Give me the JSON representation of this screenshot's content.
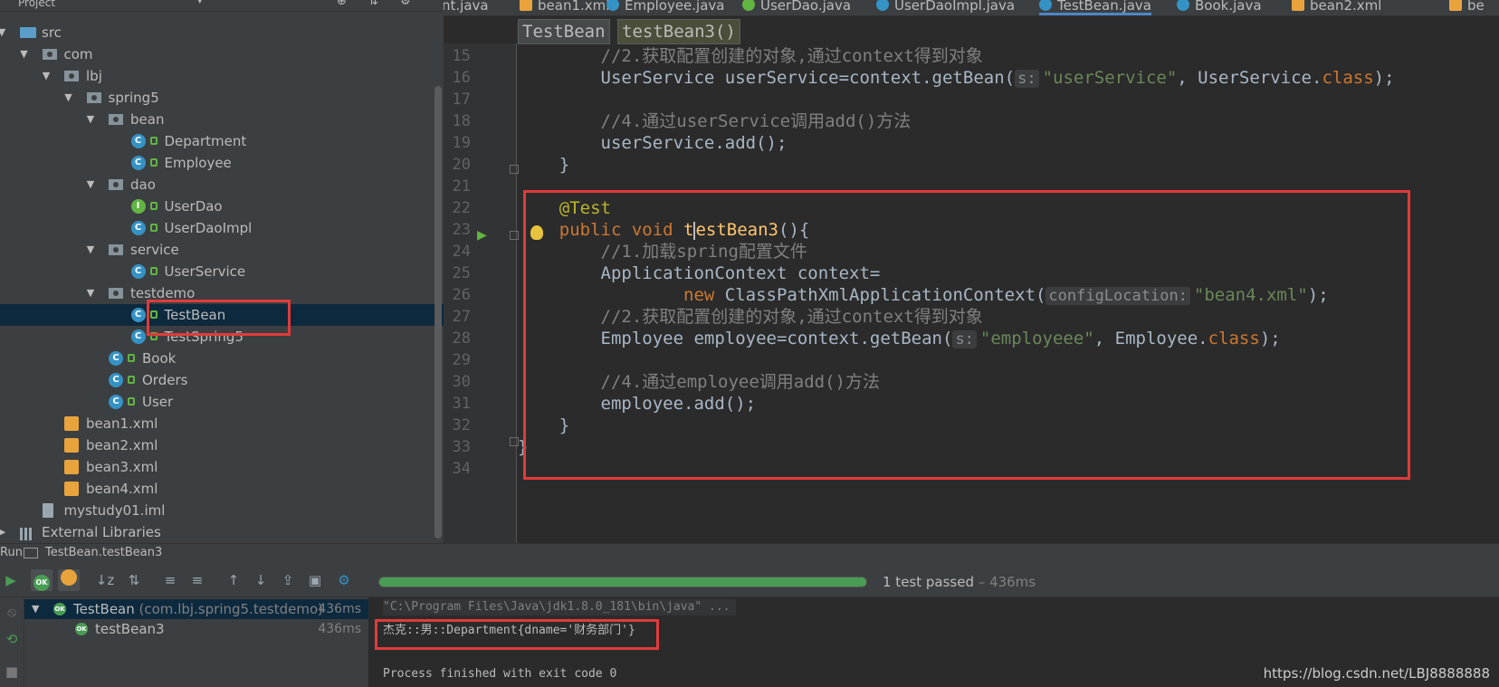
{
  "project": {
    "title": "Project",
    "tree": [
      {
        "label": "src",
        "icon": "source-folder-icon",
        "depth": 0,
        "arrow": "expanded"
      },
      {
        "label": "com",
        "icon": "package-icon",
        "depth": 1,
        "arrow": "expanded"
      },
      {
        "label": "lbj",
        "icon": "package-icon",
        "depth": 2,
        "arrow": "expanded"
      },
      {
        "label": "spring5",
        "icon": "package-icon",
        "depth": 3,
        "arrow": "expanded"
      },
      {
        "label": "bean",
        "icon": "package-icon",
        "depth": 4,
        "arrow": "expanded"
      },
      {
        "label": "Department",
        "icon": "class-icon",
        "depth": 5,
        "arrow": "none"
      },
      {
        "label": "Employee",
        "icon": "class-icon",
        "depth": 5,
        "arrow": "none"
      },
      {
        "label": "dao",
        "icon": "package-icon",
        "depth": 4,
        "arrow": "expanded"
      },
      {
        "label": "UserDao",
        "icon": "interface-icon",
        "depth": 5,
        "arrow": "none"
      },
      {
        "label": "UserDaoImpl",
        "icon": "class-icon",
        "depth": 5,
        "arrow": "none"
      },
      {
        "label": "service",
        "icon": "package-icon",
        "depth": 4,
        "arrow": "expanded"
      },
      {
        "label": "UserService",
        "icon": "class-icon",
        "depth": 5,
        "arrow": "none"
      },
      {
        "label": "testdemo",
        "icon": "package-icon",
        "depth": 4,
        "arrow": "expanded"
      },
      {
        "label": "TestBean",
        "icon": "class-icon",
        "depth": 5,
        "arrow": "none",
        "selected": true
      },
      {
        "label": "TestSpring5",
        "icon": "class-icon",
        "depth": 5,
        "arrow": "none"
      },
      {
        "label": "Book",
        "icon": "class-icon",
        "depth": 4,
        "arrow": "none"
      },
      {
        "label": "Orders",
        "icon": "class-icon",
        "depth": 4,
        "arrow": "none"
      },
      {
        "label": "User",
        "icon": "class-icon",
        "depth": 4,
        "arrow": "none"
      },
      {
        "label": "bean1.xml",
        "icon": "xml-file-icon",
        "depth": 2,
        "arrow": "none"
      },
      {
        "label": "bean2.xml",
        "icon": "xml-file-icon",
        "depth": 2,
        "arrow": "none"
      },
      {
        "label": "bean3.xml",
        "icon": "xml-file-icon",
        "depth": 2,
        "arrow": "none"
      },
      {
        "label": "bean4.xml",
        "icon": "xml-file-icon",
        "depth": 2,
        "arrow": "none"
      },
      {
        "label": "mystudy01.iml",
        "icon": "iml-file-icon",
        "depth": 1,
        "arrow": "none"
      },
      {
        "label": "External Libraries",
        "icon": "library-icon",
        "depth": 0,
        "arrow": "collapsed"
      }
    ]
  },
  "tabs": [
    {
      "label": "nt.java",
      "icon": "class-icon"
    },
    {
      "label": "bean1.xml",
      "icon": "xml-file-icon"
    },
    {
      "label": "Employee.java",
      "icon": "class-icon"
    },
    {
      "label": "UserDao.java",
      "icon": "interface-icon"
    },
    {
      "label": "UserDaoImpl.java",
      "icon": "class-icon"
    },
    {
      "label": "TestBean.java",
      "icon": "class-icon",
      "active": true
    },
    {
      "label": "Book.java",
      "icon": "class-icon"
    },
    {
      "label": "bean2.xml",
      "icon": "xml-file-icon"
    },
    {
      "label": "be",
      "icon": "xml-file-icon"
    }
  ],
  "breadcrumb": {
    "class": "TestBean",
    "method": "testBean3()"
  },
  "editor": {
    "lines": [
      {
        "n": "15",
        "segs": [
          [
            "cm",
            "        //2.获取配置创建的对象,通过context得到对象"
          ]
        ]
      },
      {
        "n": "16",
        "segs": [
          [
            "",
            "        UserService userService=context.getBean("
          ],
          [
            "hint",
            "s:"
          ],
          [
            "str",
            "\"userService\""
          ],
          [
            "",
            ", UserService."
          ],
          [
            "kw",
            "class"
          ],
          [
            "",
            ");"
          ]
        ]
      },
      {
        "n": "17",
        "segs": []
      },
      {
        "n": "18",
        "segs": [
          [
            "cm",
            "        //4.通过userService调用add()方法"
          ]
        ]
      },
      {
        "n": "19",
        "segs": [
          [
            "",
            "        userService.add();"
          ]
        ]
      },
      {
        "n": "20",
        "segs": [
          [
            "",
            "    }"
          ]
        ]
      },
      {
        "n": "21",
        "segs": []
      },
      {
        "n": "22",
        "segs": [
          [
            "an",
            "    @Test"
          ]
        ]
      },
      {
        "n": "23",
        "segs": [
          [
            "kw",
            "    public void "
          ],
          [
            "fn",
            "t"
          ],
          [
            "caret",
            ""
          ],
          [
            "fn",
            "estBean3"
          ],
          [
            "",
            "(){"
          ]
        ]
      },
      {
        "n": "24",
        "segs": [
          [
            "cm",
            "        //1.加载spring配置文件"
          ]
        ]
      },
      {
        "n": "25",
        "segs": [
          [
            "",
            "        ApplicationContext context="
          ]
        ]
      },
      {
        "n": "26",
        "segs": [
          [
            "kw",
            "                new "
          ],
          [
            "",
            "ClassPathXmlApplicationContext("
          ],
          [
            "hint",
            "configLocation:"
          ],
          [
            "str",
            "\"bean4.xml\""
          ],
          [
            "",
            ");"
          ]
        ]
      },
      {
        "n": "27",
        "segs": [
          [
            "cm",
            "        //2.获取配置创建的对象,通过context得到对象"
          ]
        ]
      },
      {
        "n": "28",
        "segs": [
          [
            "",
            "        Employee employee=context.getBean("
          ],
          [
            "hint",
            "s:"
          ],
          [
            "str",
            "\"employeee\""
          ],
          [
            "",
            ", Employee."
          ],
          [
            "kw",
            "class"
          ],
          [
            "",
            ");"
          ]
        ]
      },
      {
        "n": "29",
        "segs": []
      },
      {
        "n": "30",
        "segs": [
          [
            "cm",
            "        //4.通过employee调用add()方法"
          ]
        ]
      },
      {
        "n": "31",
        "segs": [
          [
            "",
            "        employee.add();"
          ]
        ]
      },
      {
        "n": "32",
        "segs": [
          [
            "",
            "    }"
          ]
        ]
      },
      {
        "n": "33",
        "segs": [
          [
            "",
            "}"
          ]
        ]
      },
      {
        "n": "34",
        "segs": []
      }
    ]
  },
  "run": {
    "title": "Run",
    "config": "TestBean.testBean3",
    "status": "1 test passed",
    "duration": " – 436ms",
    "progress_fraction": 1.0,
    "tests": [
      {
        "name": "TestBean",
        "detail": " (com.lbj.spring5.testdemo)",
        "time": "436ms",
        "selected": true
      },
      {
        "name": "testBean3",
        "detail": "",
        "time": "436ms",
        "selected": false
      }
    ],
    "console": {
      "command": "\"C:\\Program Files\\Java\\jdk1.8.0_181\\bin\\java\" ...",
      "output": "杰克::男::Department{dname='财务部门'}",
      "finish": "Process finished with exit code 0"
    },
    "ok_badge": "OK"
  },
  "watermark": "https://blog.csdn.net/LBJ8888888"
}
